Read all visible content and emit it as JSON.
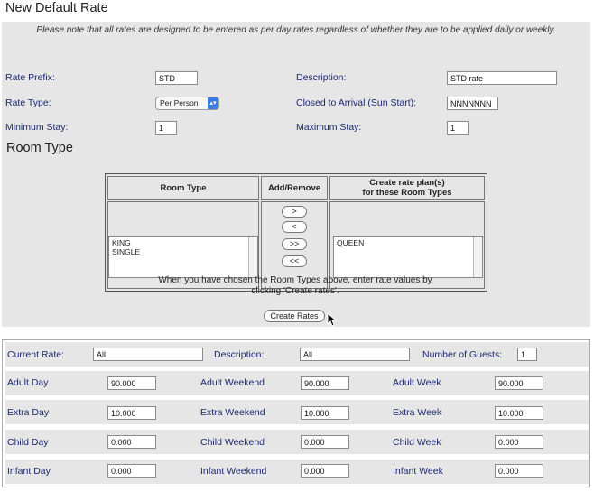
{
  "page": {
    "title": "New Default Rate",
    "note": "Please note that all rates are designed to be entered as per day rates regardless of whether they are to be applied daily or weekly."
  },
  "form": {
    "rate_prefix": {
      "label": "Rate Prefix:",
      "value": "STD"
    },
    "description": {
      "label": "Description:",
      "value": "STD rate"
    },
    "rate_type": {
      "label": "Rate Type:",
      "value": "Per Person"
    },
    "closed_to_arrival": {
      "label": "Closed to Arrival (Sun Start):",
      "value": "NNNNNNN"
    },
    "minimum_stay": {
      "label": "Minimum Stay:",
      "value": "1"
    },
    "maximum_stay": {
      "label": "Maximum Stay:",
      "value": "1"
    }
  },
  "room_type": {
    "heading": "Room Type",
    "col_room_type": "Room Type",
    "col_add_remove": "Add/Remove",
    "col_create_line1": "Create rate plan(s)",
    "col_create_line2": "for these Room Types",
    "available": [
      "KING",
      "SINGLE"
    ],
    "selected": [
      "QUEEN"
    ],
    "buttons": {
      "add": ">",
      "remove": "<",
      "add_all": ">>",
      "remove_all": "<<"
    },
    "hint_line1": "When you have chosen the Room Types above, enter rate values by",
    "hint_line2": "clicking 'Create rates'.",
    "create_button": "Create Rates"
  },
  "rates": {
    "current_rate": {
      "label": "Current Rate:",
      "value": "All"
    },
    "description": {
      "label": "Description:",
      "value": "All"
    },
    "number_of_guests": {
      "label": "Number of Guests:",
      "value": "1"
    },
    "rows": [
      [
        {
          "label": "Adult Day",
          "value": "90.000"
        },
        {
          "label": "Adult Weekend",
          "value": "90.000"
        },
        {
          "label": "Adult Week",
          "value": "90.000"
        }
      ],
      [
        {
          "label": "Extra Day",
          "value": "10.000"
        },
        {
          "label": "Extra Weekend",
          "value": "10.000"
        },
        {
          "label": "Extra Week",
          "value": "10.000"
        }
      ],
      [
        {
          "label": "Child Day",
          "value": "0.000"
        },
        {
          "label": "Child Weekend",
          "value": "0.000"
        },
        {
          "label": "Child Week",
          "value": "0.000"
        }
      ],
      [
        {
          "label": "Infant Day",
          "value": "0.000"
        },
        {
          "label": "Infant Weekend",
          "value": "0.000"
        },
        {
          "label": "Infant Week",
          "value": "0.000"
        }
      ]
    ]
  }
}
